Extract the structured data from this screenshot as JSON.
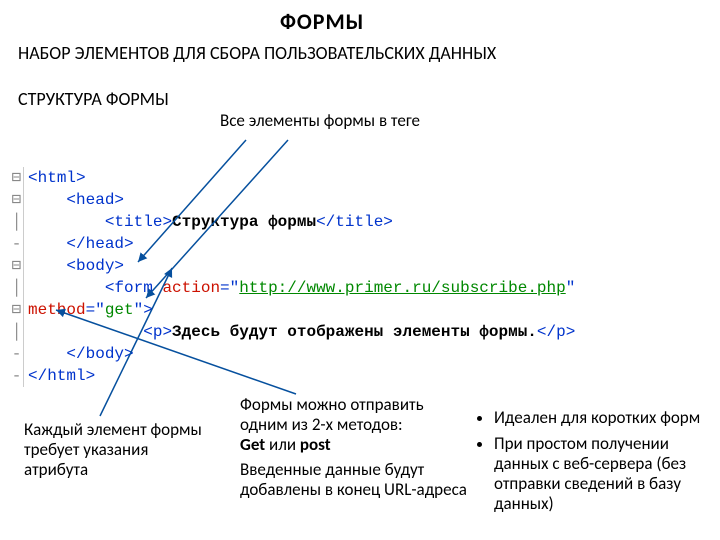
{
  "title": "ФОРМЫ",
  "heading1": "НАБОР ЭЛЕМЕНТОВ ДЛЯ СБОРА ПОЛЬЗОВАТЕЛЬСКИХ ДАННЫХ",
  "heading2": "СТРУКТУРА ФОРМЫ",
  "note_top": "Все элементы формы в теге",
  "code": {
    "l1": {
      "g": "⊟",
      "open": "<",
      "tag": "html",
      "close": ">"
    },
    "l2": {
      "g": "⊟",
      "open": "<",
      "tag": "head",
      "close": ">"
    },
    "l3": {
      "g": "│",
      "open": "<",
      "tag": "title",
      "close": ">",
      "text": "Структура формы",
      "open2": "</",
      "tag2": "title",
      "close2": ">"
    },
    "l4": {
      "g": "-",
      "open": "</",
      "tag": "head",
      "close": ">"
    },
    "l5": {
      "g": "⊟",
      "open": "<",
      "tag": "body",
      "close": ">"
    },
    "l6": {
      "g": "│",
      "open": "<",
      "tag": "form",
      "sp": " ",
      "attr1": "action",
      "eq": "=",
      "q": "\"",
      "url": "http://www.primer.ru/subscribe.php",
      "q2": "\""
    },
    "l7": {
      "g": "⊟",
      "attr2": "method",
      "eq": "=",
      "q": "\"",
      "val": "get",
      "q2": "\"",
      "close": ">"
    },
    "l8": {
      "g": "│",
      "open": "<",
      "tag": "p",
      "close": ">",
      "text": "Здесь будут отображены элементы формы.",
      "open2": "</",
      "tag2": "p",
      "close2": ">"
    },
    "l9": {
      "g": "-",
      "open": "</",
      "tag": "body",
      "close": ">"
    },
    "l10": {
      "g": "-",
      "open": "</",
      "tag": "html",
      "close": ">"
    }
  },
  "note_left": "Каждый элемент формы требует указания атрибута",
  "note_mid_a": "Формы можно отправить одним из 2-х методов:",
  "note_mid_b1": "Get",
  "note_mid_or": " или ",
  "note_mid_b2": "post",
  "note_mid2": "Введенные данные будут добавлены в конец URL-адреса",
  "bullet1": "Идеален для коротких форм",
  "bullet2": "При простом получении данных с веб-сервера (без отправки сведений в базу данных)"
}
